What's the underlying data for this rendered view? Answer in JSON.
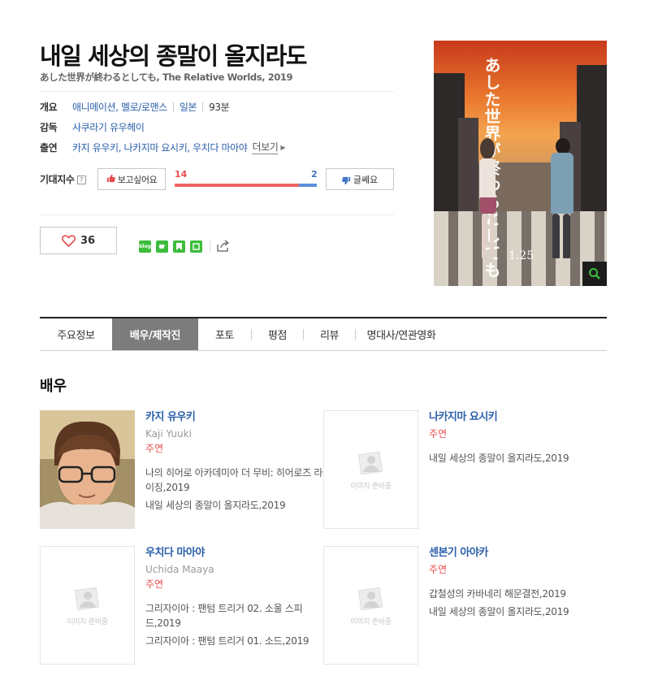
{
  "movie": {
    "title": "내일 세상의 종말이 올지라도",
    "subtitle": "あした世界が終わるとしても, The Relative Worlds, 2019"
  },
  "info": {
    "overview": {
      "label": "개요",
      "genre": "애니메이션, 멜로/로맨스",
      "country": "일본",
      "runtime": "93분"
    },
    "director": {
      "label": "감독",
      "name": "사쿠라기 유우헤이"
    },
    "cast": {
      "label": "출연",
      "names": "카지 유우키, 나카지마 요시키, 우치다 마아야",
      "more": "더보기"
    }
  },
  "expect": {
    "label": "기대지수",
    "help": "?",
    "want_label": "보고싶어요",
    "nah_label": "글쎄요",
    "want_count": "14",
    "nah_count": "2",
    "want_ratio": 0.875
  },
  "like": {
    "count": "36"
  },
  "share": {
    "blog_icon": "blog",
    "icons": [
      "blog-icon",
      "cafe-icon",
      "bookmark-icon",
      "memo-icon"
    ],
    "share_icon": "share-icon"
  },
  "poster": {
    "title": "あした世界が終わるとしても",
    "date": "1.25"
  },
  "tabs": [
    {
      "label": "주요정보",
      "active": false
    },
    {
      "label": "배우/제작진",
      "active": true
    },
    {
      "label": "포토",
      "active": false
    },
    {
      "label": "평점",
      "active": false
    },
    {
      "label": "리뷰",
      "active": false
    },
    {
      "label": "명대사/연관영화",
      "active": false
    }
  ],
  "section": {
    "title": "배우",
    "no_image": "이미지 준비중"
  },
  "actors": [
    {
      "name": "카지 유우키",
      "name_en": "Kaji Yuuki",
      "role": "주연",
      "has_photo": true,
      "works": [
        "나의 히어로 아카데미아 더 무비: 히어로즈 라이징,2019",
        "내일 세상의 종말이 올지라도,2019"
      ]
    },
    {
      "name": "나카지마 요시키",
      "name_en": "",
      "role": "주연",
      "has_photo": false,
      "works": [
        "내일 세상의 종말이 올지라도,2019"
      ]
    },
    {
      "name": "우치다 마아야",
      "name_en": "Uchida Maaya",
      "role": "주연",
      "has_photo": false,
      "works": [
        "그리자이아 : 팬텀 트리거 02. 소울 스피드,2019",
        "그리자이아 : 팬텀 트리거 01. 소드,2019"
      ]
    },
    {
      "name": "센본기 아야카",
      "name_en": "",
      "role": "주연",
      "has_photo": false,
      "works": [
        "갑철성의 카바네리 해문결전,2019",
        "내일 세상의 종말이 올지라도,2019"
      ]
    }
  ]
}
